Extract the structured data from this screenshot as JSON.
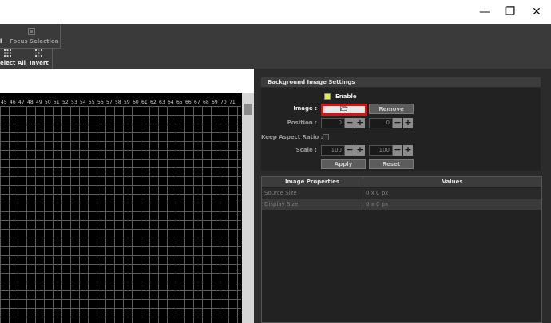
{
  "window": {
    "minimize_glyph": "—",
    "restore_glyph": "❐",
    "close_glyph": "✕"
  },
  "toolbar": {
    "partial_left": "l",
    "focus_selection": "Focus Selection",
    "select_all": "elect All",
    "invert": "Invert"
  },
  "ruler": {
    "labels": [
      "45",
      "46",
      "47",
      "48",
      "49",
      "50",
      "51",
      "52",
      "53",
      "54",
      "55",
      "56",
      "57",
      "58",
      "59",
      "60",
      "61",
      "62",
      "63",
      "64",
      "65",
      "66",
      "67",
      "68",
      "69",
      "70",
      "71"
    ]
  },
  "settings": {
    "title": "Background Image Settings",
    "enable_label": "Enable",
    "enable_checked": true,
    "image_label": "Image :",
    "image_button_icon": "folder-open-icon",
    "image_button_glyph": "🗁",
    "remove_label": "Remove",
    "position_label": "Position :",
    "position_x": "0",
    "position_y": "0",
    "keep_aspect_label": "Keep Aspect Ratio :",
    "keep_aspect_checked": false,
    "scale_label": "Scale :",
    "scale_x": "100",
    "scale_y": "100",
    "apply_label": "Apply",
    "reset_label": "Reset",
    "minus_glyph": "−",
    "plus_glyph": "+"
  },
  "properties": {
    "col_property": "Image Properties",
    "col_values": "Values",
    "rows": [
      {
        "name": "Source Size",
        "value": "0 x 0 px"
      },
      {
        "name": "Display Size",
        "value": "0 x 0 px"
      }
    ]
  },
  "colors": {
    "accent_highlight": "#e01010",
    "checkbox_on": "#e4f236"
  }
}
